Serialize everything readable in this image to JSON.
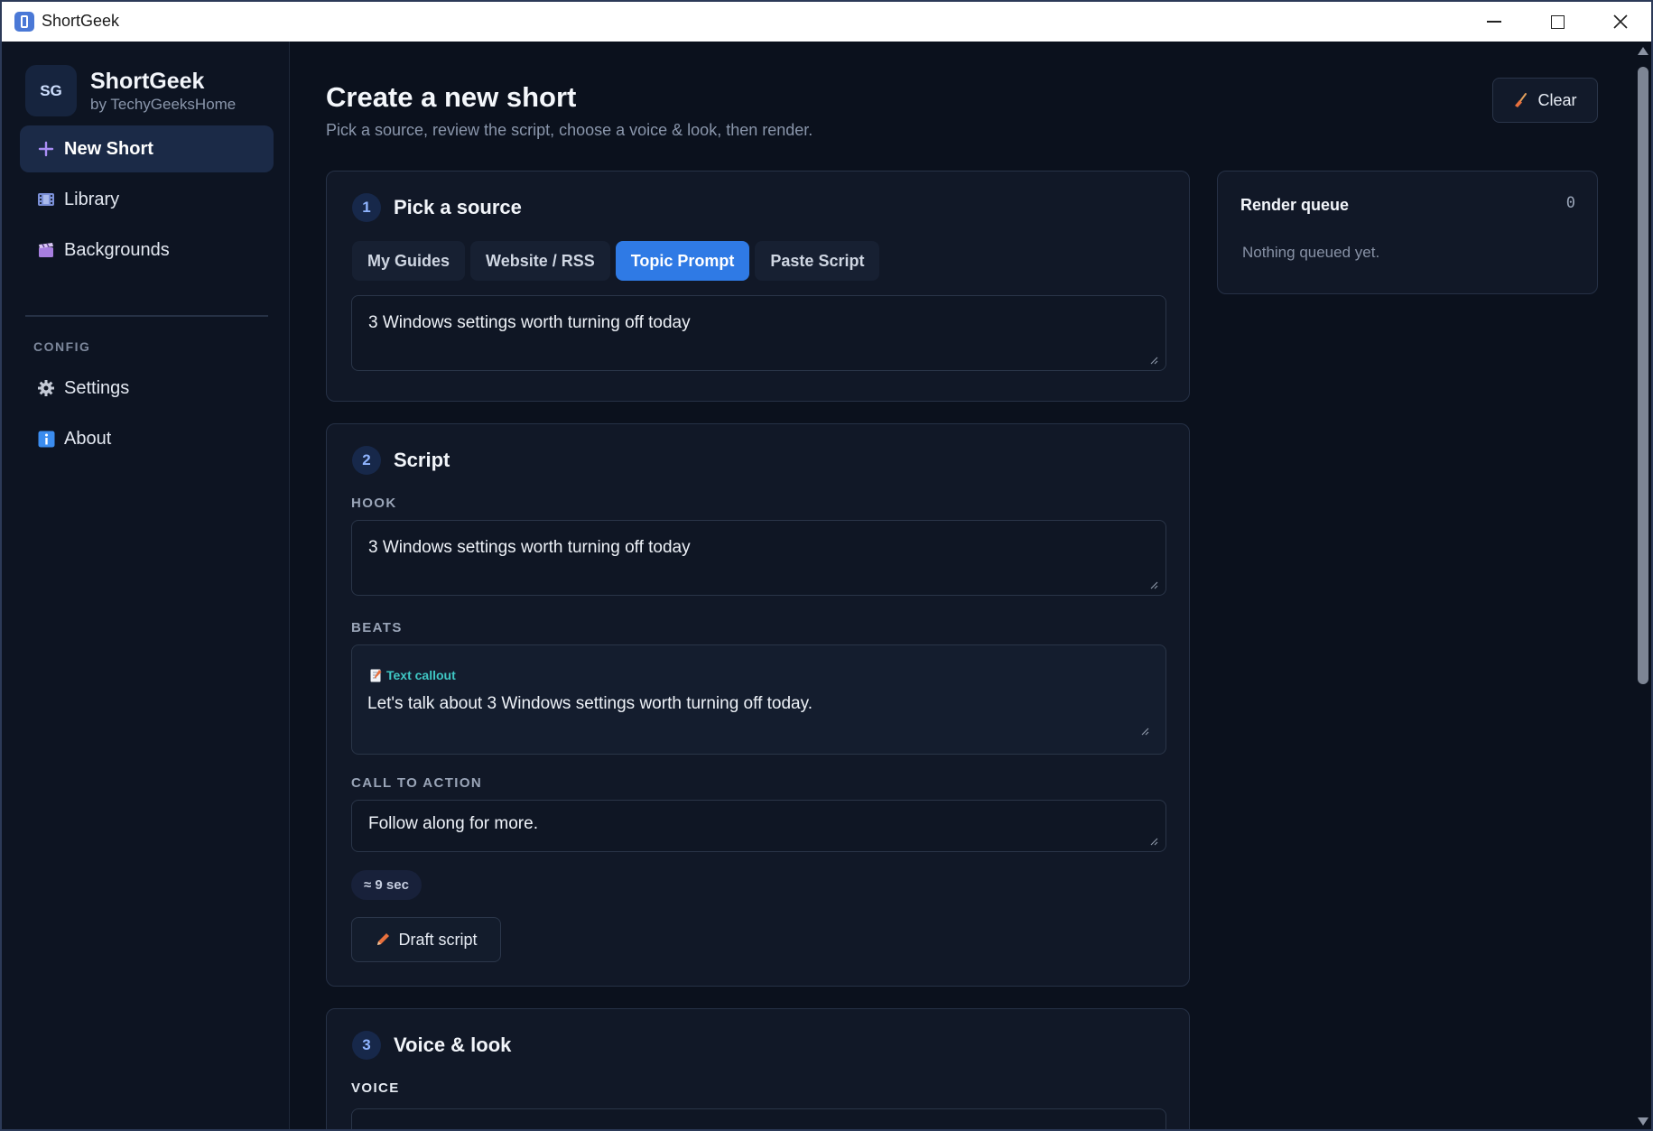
{
  "window": {
    "title": "ShortGeek"
  },
  "brand": {
    "badge": "SG",
    "name": "ShortGeek",
    "subtitle": "by TechyGeeksHome"
  },
  "sidebar": {
    "items": [
      {
        "label": "New Short",
        "icon": "plus-icon",
        "active": true
      },
      {
        "label": "Library",
        "icon": "film-icon"
      },
      {
        "label": "Backgrounds",
        "icon": "clapperboard-icon"
      }
    ],
    "config_label": "CONFIG",
    "config_items": [
      {
        "label": "Settings",
        "icon": "gear-icon"
      },
      {
        "label": "About",
        "icon": "info-icon"
      }
    ]
  },
  "header": {
    "title": "Create a new short",
    "subtitle": "Pick a source, review the script, choose a voice & look, then render.",
    "clear_label": "Clear"
  },
  "source": {
    "step": "1",
    "title": "Pick a source",
    "tabs": [
      "My Guides",
      "Website / RSS",
      "Topic Prompt",
      "Paste Script"
    ],
    "active_tab": "Topic Prompt",
    "prompt_value": "3 Windows settings worth turning off today"
  },
  "script": {
    "step": "2",
    "title": "Script",
    "hook_label": "HOOK",
    "hook_value": "3 Windows settings worth turning off today",
    "beats_label": "BEATS",
    "beat": {
      "kind": "Text callout",
      "text": "Let's talk about 3 Windows settings worth turning off today."
    },
    "cta_label": "CALL TO ACTION",
    "cta_value": "Follow along for more.",
    "duration": "≈ 9 sec",
    "draft_label": "Draft script"
  },
  "voice": {
    "step": "3",
    "title": "Voice & look",
    "voice_label": "VOICE"
  },
  "queue": {
    "title": "Render queue",
    "count": "0",
    "empty_text": "Nothing queued yet."
  },
  "colors": {
    "accent": "#2f7ae5",
    "background": "#0b111d",
    "card": "#111827",
    "callout": "#3fc7c4"
  }
}
